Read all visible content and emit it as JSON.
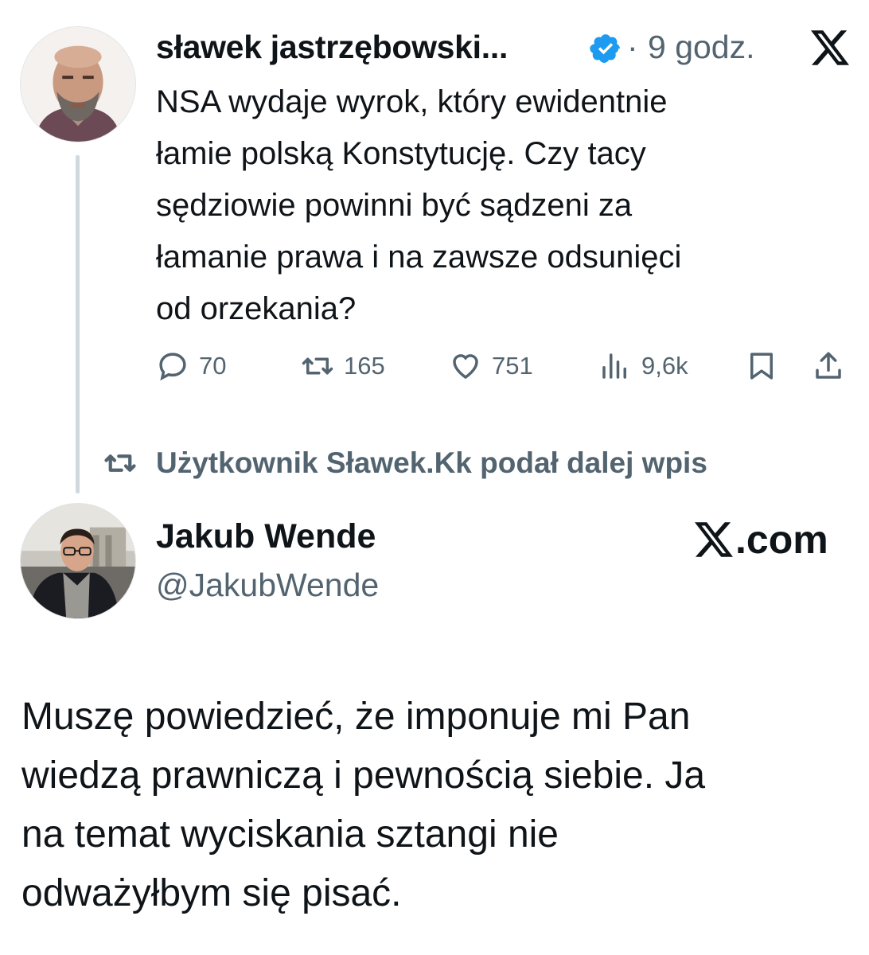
{
  "tweet": {
    "author_name": "sławek jastrzębowski...",
    "separator": "·",
    "timestamp": "9 godz.",
    "text": "NSA wydaje wyrok, który ewidentnie\nłamie polską Konstytucję. Czy tacy\nsędziowie powinni być sądzeni za\nłamanie prawa i na zawsze odsunięci\nod orzekania?",
    "metrics": {
      "replies": "70",
      "reposts": "165",
      "likes": "751",
      "views": "9,6k"
    }
  },
  "repost_notice": "Użytkownik Sławek.Kk podał dalej wpis",
  "quoted": {
    "author_name": "Jakub Wende",
    "handle": "@JakubWende",
    "brand_suffix": ".com",
    "text": "Muszę powiedzieć, że imponuje mi Pan\nwiedzą prawniczą i pewnością siebie. Ja\nna temat wyciskania sztangi nie\nodważyłbym się pisać."
  },
  "icons": {
    "verified": "verified-badge-icon",
    "platform": "x-logo-icon",
    "reply": "reply-icon",
    "repost": "repost-icon",
    "like": "heart-icon",
    "views": "views-icon",
    "bookmark": "bookmark-icon",
    "share": "share-icon"
  },
  "colors": {
    "text": "#0f1419",
    "secondary": "#536471",
    "verified": "#1d9bf0",
    "thread_line": "#cfd9de"
  }
}
